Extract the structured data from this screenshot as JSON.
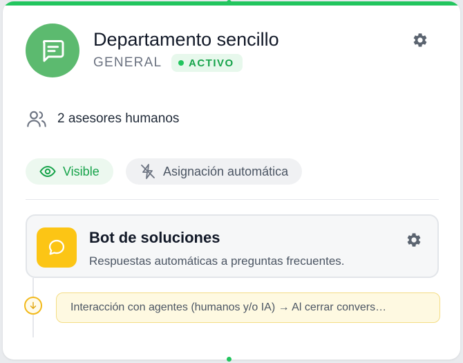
{
  "department": {
    "title": "Departamento sencillo",
    "category": "GENERAL",
    "status": "ACTIVO",
    "icon": "chat-message-icon",
    "settings_icon": "gear-icon"
  },
  "advisors": {
    "icon": "users-icon",
    "label": "2 asesores humanos"
  },
  "chips": {
    "visible": {
      "icon": "eye-icon",
      "label": "Visible"
    },
    "auto_assign": {
      "icon": "auto-assign-off-icon",
      "label": "Asignación automática"
    }
  },
  "bot": {
    "icon": "speech-bubble-icon",
    "title": "Bot de soluciones",
    "description": "Respuestas automáticas a preguntas frecuentes.",
    "settings_icon": "gear-icon"
  },
  "flow": {
    "marker_icon": "arrow-down-circle-icon",
    "text": "Interacción con agentes (humanos y/o IA) → Al cerrar convers…"
  },
  "colors": {
    "accent_green": "#22c55e",
    "avatar_green": "#5cba6f",
    "bot_yellow": "#fcc515"
  }
}
